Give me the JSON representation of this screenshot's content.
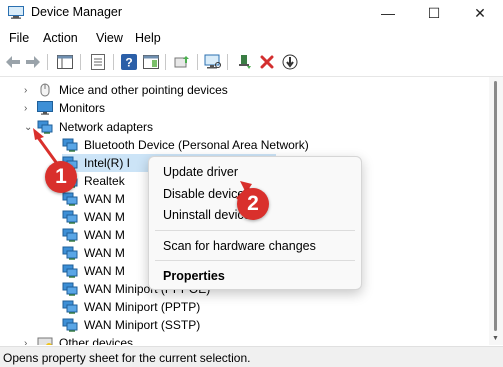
{
  "window": {
    "title": "Device Manager",
    "minimize_glyph": "—",
    "maximize_glyph": "☐",
    "close_glyph": "✕"
  },
  "menu": {
    "file": "File",
    "action": "Action",
    "view": "View",
    "help": "Help"
  },
  "toolbar": {
    "icons": [
      "back-icon",
      "forward-icon",
      "show-hide-console-tree-icon",
      "properties-icon",
      "help-icon",
      "action-pane-icon",
      "update-driver-icon",
      "scan-hardware-icon",
      "enable-device-icon",
      "uninstall-device-icon",
      "disable-device-icon"
    ]
  },
  "tree": {
    "mice": "Mice and other pointing devices",
    "monitors": "Monitors",
    "network_adapters": "Network adapters",
    "children": [
      "Bluetooth Device (Personal Area Network)",
      "Intel(R) I",
      "Realtek",
      "WAN M",
      "WAN M",
      "WAN M",
      "WAN M",
      "WAN M",
      "WAN Miniport (PPPOE)",
      "WAN Miniport (PPTP)",
      "WAN Miniport (SSTP)"
    ],
    "other_devices": "Other devices"
  },
  "context_menu": {
    "update_driver": "Update driver",
    "disable_device": "Disable device",
    "uninstall_device": "Uninstall device",
    "scan_hardware": "Scan for hardware changes",
    "properties": "Properties"
  },
  "annotations": {
    "step1": "1",
    "step2": "2",
    "color": "#d9302c"
  },
  "status": {
    "text": "Opens property sheet for the current selection."
  }
}
